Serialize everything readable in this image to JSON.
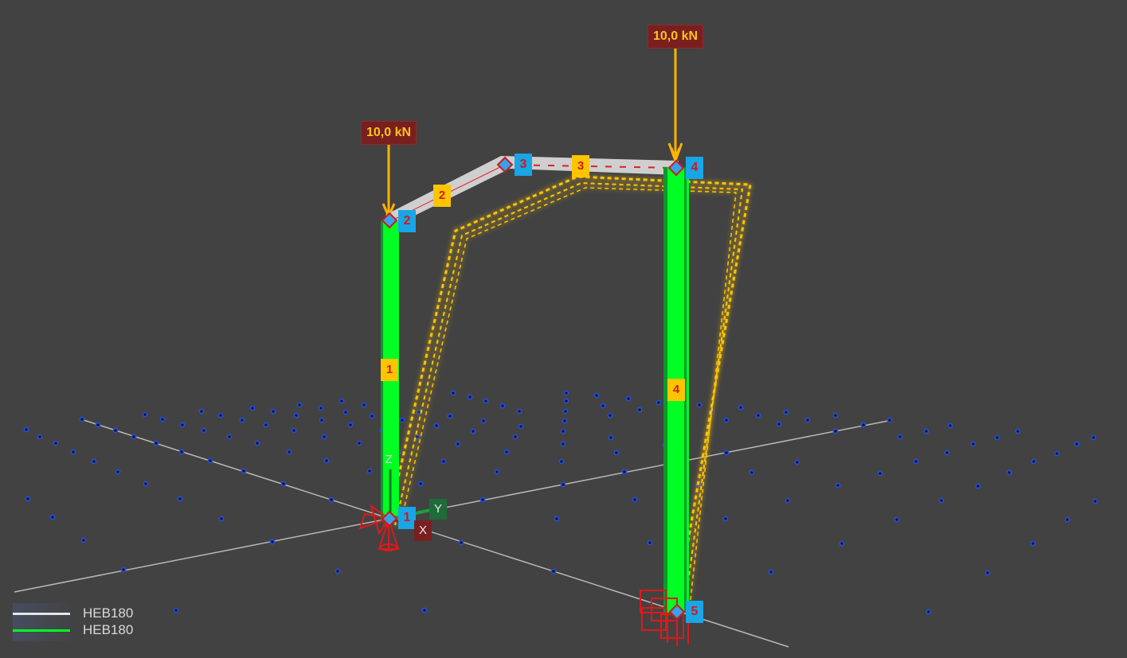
{
  "colors": {
    "background": "#424242",
    "column_member": "#00ff22",
    "beam_member": "#cfcfcf",
    "deformed_shape": "#ffc400",
    "load_arrow": "#ffb300",
    "node_label_bg": "#18a6e6",
    "label_text": "#d31818",
    "support": "#e01818",
    "grid_point": "#1a3ec8"
  },
  "loads": [
    {
      "value": "10,0 kN"
    },
    {
      "value": "10,0 kN"
    }
  ],
  "nodes": [
    "1",
    "2",
    "3",
    "4",
    "5"
  ],
  "members": [
    "1",
    "2",
    "3",
    "4"
  ],
  "axes": {
    "x": "X",
    "y": "Y",
    "z": "Z"
  },
  "legend": [
    {
      "label": "HEB180",
      "color": "#e6e6e6"
    },
    {
      "label": "HEB180",
      "color": "#00ff22"
    }
  ]
}
